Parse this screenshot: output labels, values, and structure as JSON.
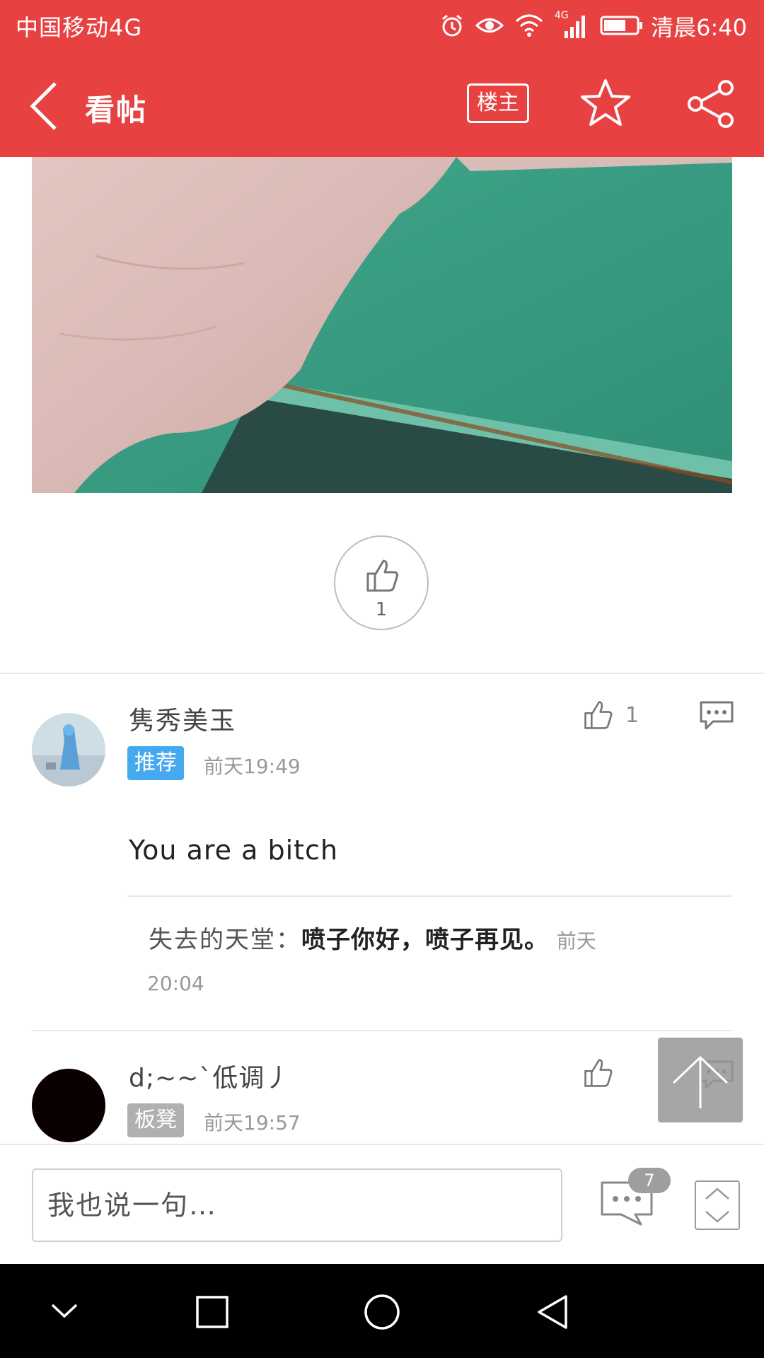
{
  "status_bar": {
    "carrier": "中国移动4G",
    "time": "清晨6:40",
    "network_badge": "4G",
    "icons": [
      "alarm-icon",
      "eye-icon",
      "wifi-icon",
      "signal-icon",
      "battery-icon"
    ]
  },
  "header": {
    "title": "看帖",
    "owner_label": "楼主",
    "background_color": "#e84142"
  },
  "post": {
    "like_count": "1"
  },
  "comments": [
    {
      "username": "隽秀美玉",
      "badge": "推荐",
      "badge_color": "#45a9f0",
      "time": "前天19:49",
      "like_count": "1",
      "text": "You are a bitch",
      "reply": {
        "name": "失去的天堂：",
        "text": "喷子你好，喷子再见。",
        "time_part1": "前天",
        "time_part2": "20:04"
      }
    },
    {
      "username": "d;~~`低调丿",
      "badge": "板凳",
      "badge_color": "#b0b0b0",
      "time": "前天19:57"
    }
  ],
  "bottom_bar": {
    "input_placeholder": "我也说一句…",
    "comment_count": "7"
  }
}
